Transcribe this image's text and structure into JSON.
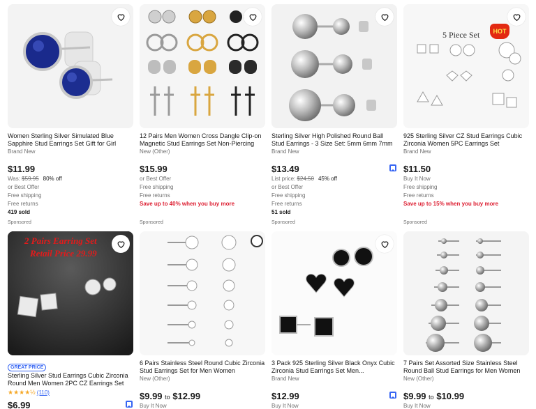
{
  "products": [
    {
      "title": "Women Sterling Silver Simulated Blue Sapphire Stud Earrings Set Gift for Girl",
      "condition": "Brand New",
      "price": "$11.99",
      "was_label": "Was:",
      "was_price": "$59.95",
      "discount": "80% off",
      "best_offer": "or Best Offer",
      "shipping": "Free shipping",
      "returns": "Free returns",
      "sold": "419 sold",
      "sponsored": "Sponsored"
    },
    {
      "title": "12 Pairs Men Women Cross Dangle Clip-on Magnetic Stud Earrings Set Non-Piercing",
      "condition": "New (Other)",
      "price": "$15.99",
      "best_offer": "or Best Offer",
      "shipping": "Free shipping",
      "returns": "Free returns",
      "promo": "Save up to 40% when you buy more",
      "sponsored": "Sponsored"
    },
    {
      "title": "Sterling Silver High Polished Round Ball Stud Earrings - 3 Size Set: 5mm 6mm 7mm",
      "condition": "Brand New",
      "price": "$13.49",
      "list_label": "List price:",
      "list_price": "$24.50",
      "discount": "45% off",
      "best_offer": "or Best Offer",
      "shipping": "Free shipping",
      "returns": "Free returns",
      "sold": "51 sold",
      "sponsored": "Sponsored"
    },
    {
      "title": "925 Sterling Silver CZ Stud Earrings Cubic Zirconia Women 5PC Earrings Set",
      "condition": "Brand New",
      "price": "$11.50",
      "buy_now": "Buy It Now",
      "shipping": "Free shipping",
      "returns": "Free returns",
      "promo": "Save up to 15% when you buy more",
      "sponsored": "Sponsored",
      "image_text": "5 Piece Set",
      "image_badge": "HOT"
    },
    {
      "badge": "GREAT PRICE",
      "title": "Sterling Silver Stud Earrings Cubic Zirconia Round Men Women 2PC CZ Earrings Set",
      "rating_stars": "★★★★½",
      "rating_count": "(110)",
      "price": "$6.99",
      "image_line1": "2 Pairs Earring Set",
      "image_line2": "Retail Price 29.99"
    },
    {
      "title": "6 Pairs Stainless Steel Round Cubic Zirconia Stud Earrings Set for Men Women",
      "condition": "New (Other)",
      "price_low": "$9.99",
      "price_to": "to",
      "price_high": "$12.99",
      "buy_now": "Buy It Now"
    },
    {
      "title": "3 Pack 925 Sterling Silver Black Onyx Cubic Zirconia Stud Earrings Set Men...",
      "condition": "Brand New",
      "price": "$12.99",
      "buy_now": "Buy It Now"
    },
    {
      "title": "7 Pairs Set Assorted Size Stainless Steel Round Ball Stud Earrings for Men Women",
      "condition": "New (Other)",
      "price_low": "$9.99",
      "price_to": "to",
      "price_high": "$10.99",
      "buy_now": "Buy It Now"
    }
  ],
  "colors": {
    "accent_blue": "#3665f3",
    "promo_red": "#dd1e31",
    "muted_text": "#707070",
    "star_gold": "#f5a623"
  },
  "icons": [
    "heart-icon",
    "bookmark-icon",
    "star-icon"
  ]
}
